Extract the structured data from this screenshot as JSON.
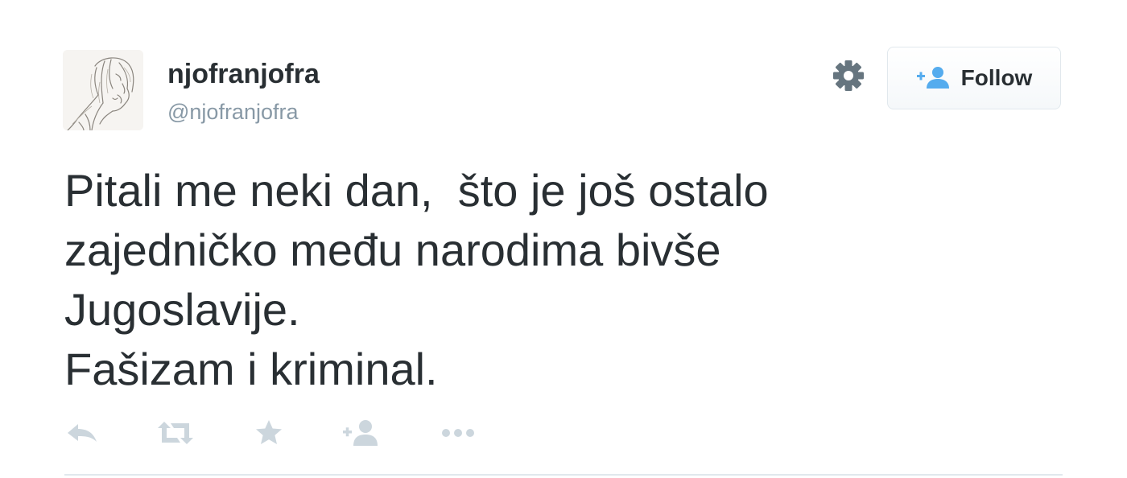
{
  "user": {
    "fullname": "njofranjofra",
    "username": "@njofranjofra"
  },
  "header": {
    "settings_icon": "gear-icon",
    "follow_label": "Follow",
    "follow_icon": "add-user-icon",
    "accent_color": "#55acee"
  },
  "tweet": {
    "lines": [
      "Pitali me neki dan,  što je još ostalo",
      "zajedničko među narodima bivše",
      "Jugoslavije.",
      "Fašizam i kriminal."
    ]
  },
  "actions": {
    "icons": [
      "reply-icon",
      "retweet-icon",
      "favorite-icon",
      "follow-icon",
      "more-icon"
    ],
    "icon_color": "#ccd6dd"
  }
}
